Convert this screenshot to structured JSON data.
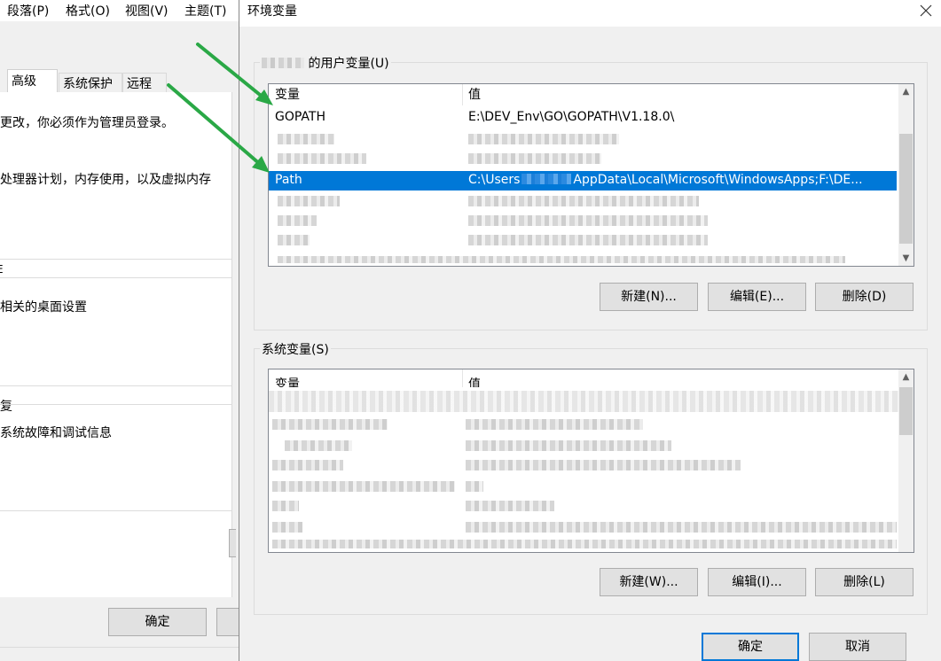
{
  "bg_window": {
    "menu": [
      "段落(P)",
      "格式(O)",
      "视图(V)",
      "主题(T)"
    ],
    "tabs": [
      "高级",
      "系统保护",
      "远程"
    ],
    "lines": [
      "更改，你必须作为管理员登录。",
      "处理器计划，内存使用，以及虚拟内存",
      "E",
      "相关的桌面设置",
      "复",
      "系统故障和调试信息"
    ],
    "ok_label": "确定"
  },
  "dialog": {
    "title": "环境变量",
    "user_group": {
      "legend": "的用户变量(U)",
      "col_var": "变量",
      "col_val": "值",
      "rows": [
        {
          "var": "GOPATH",
          "val": "E:\\DEV_Env\\GO\\GOPATH\\V1.18.0\\"
        },
        {
          "var": "Path",
          "val_prefix": "C:\\Users",
          "val_suffix": "AppData\\Local\\Microsoft\\WindowsApps;F:\\DE..."
        }
      ],
      "btn_new": "新建(N)...",
      "btn_edit": "编辑(E)...",
      "btn_delete": "删除(D)"
    },
    "system_group": {
      "legend": "系统变量(S)",
      "col_var": "变量",
      "col_val": "值",
      "btn_new": "新建(W)...",
      "btn_edit": "编辑(I)...",
      "btn_delete": "删除(L)"
    },
    "ok_label": "确定",
    "cancel_label": "取消"
  },
  "colors": {
    "selection": "#0078d7",
    "annotation_arrow": "#2aa846"
  }
}
